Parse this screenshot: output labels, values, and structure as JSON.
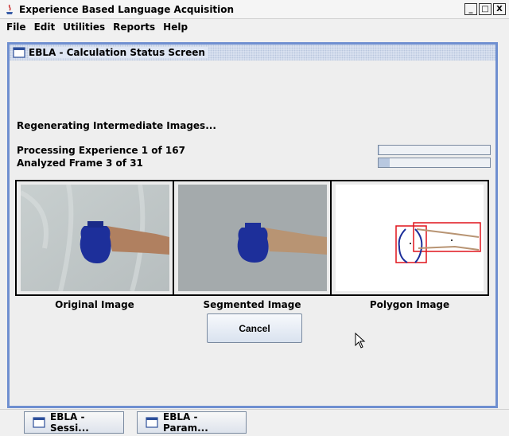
{
  "window": {
    "title": "Experience Based Language Acquisition",
    "controls": {
      "minimize": "_",
      "maximize": "□",
      "close": "X"
    }
  },
  "menu": [
    "File",
    "Edit",
    "Utilities",
    "Reports",
    "Help"
  ],
  "frame": {
    "title": "EBLA - Calculation Status Screen",
    "status_message": "Regenerating Intermediate Images...",
    "experience_progress": {
      "label": "Processing Experience 1 of 167",
      "fraction": 0.006
    },
    "frame_progress": {
      "label": "Analyzed Frame 3 of 31",
      "fraction": 0.097
    },
    "images": [
      {
        "caption": "Original Image"
      },
      {
        "caption": "Segmented Image"
      },
      {
        "caption": "Polygon Image"
      }
    ],
    "cancel_label": "Cancel"
  },
  "taskbar": [
    {
      "label": "EBLA - Sessi..."
    },
    {
      "label": "EBLA - Param..."
    }
  ],
  "colors": {
    "frame_border": "#6f8fd0",
    "vase": "#1d2f9a",
    "polygon_box": "#e0141c"
  }
}
